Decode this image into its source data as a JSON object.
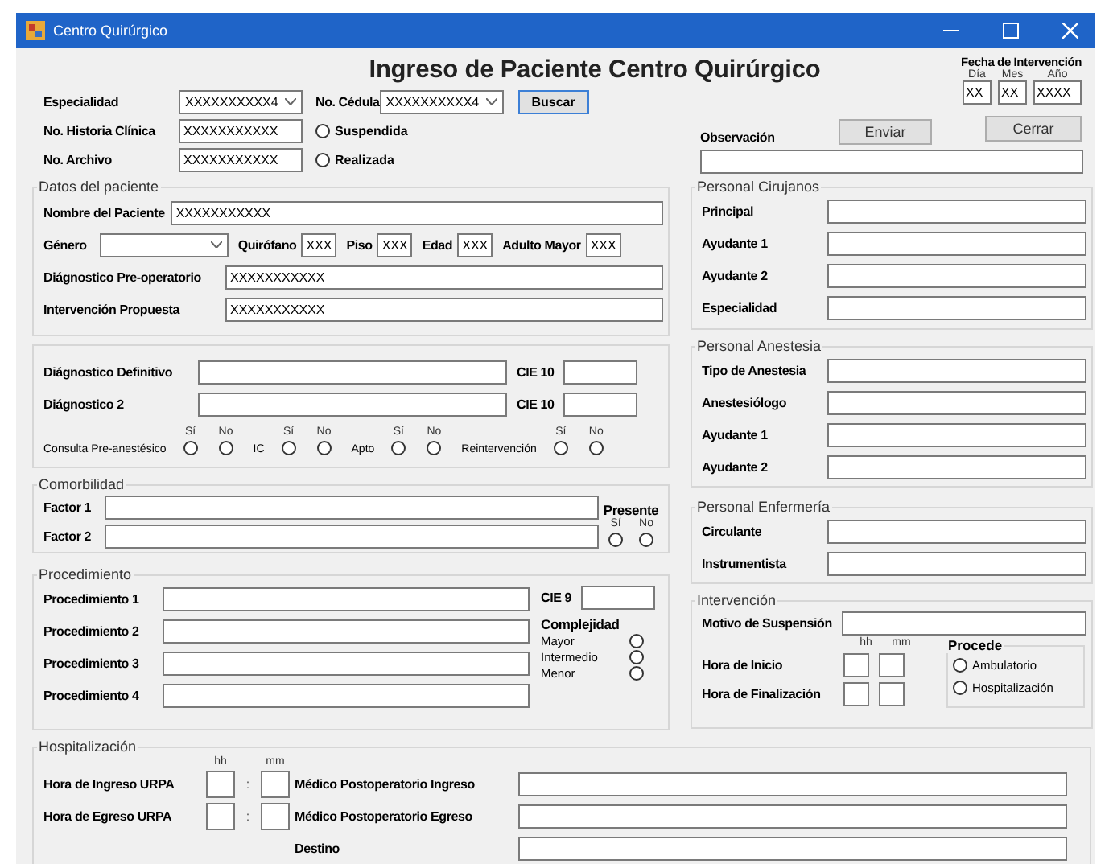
{
  "window": {
    "title": "Centro Quirúrgico"
  },
  "heading": "Ingreso de Paciente Centro Quirúrgico",
  "fecha": {
    "label": "Fecha de Intervención",
    "parts": [
      {
        "caption": "Día",
        "value": "XX"
      },
      {
        "caption": "Mes",
        "value": "XX"
      },
      {
        "caption": "Año",
        "value": "XXXX"
      }
    ]
  },
  "especialidad": {
    "label": "Especialidad",
    "value": "XXXXXXXXXX4"
  },
  "cedula": {
    "label": "No. Cédula",
    "value": "XXXXXXXXXX4"
  },
  "buscar": "Buscar",
  "historia": {
    "label": "No. Historia Clínica",
    "value": "XXXXXXXXXXX"
  },
  "archivo": {
    "label": "No. Archivo",
    "value": "XXXXXXXXXXX"
  },
  "estado": [
    {
      "label": "Suspendida",
      "selected": false
    },
    {
      "label": "Realizada",
      "selected": false
    }
  ],
  "observacion": {
    "label": "Observación"
  },
  "enviar": "Enviar",
  "cerrar": "Cerrar",
  "datos_paciente": {
    "title": "Datos del paciente",
    "nombre": {
      "label": "Nombre del Paciente",
      "value": "XXXXXXXXXXX"
    },
    "genero": {
      "label": "Género"
    },
    "small": [
      {
        "label": "Quirófano",
        "value": "XXX"
      },
      {
        "label": "Piso",
        "value": "XXX"
      },
      {
        "label": "Edad",
        "value": "XXX"
      },
      {
        "label": "Adulto Mayor",
        "value": "XXX"
      }
    ],
    "lines": [
      {
        "label": "Diágnostico Pre-operatorio",
        "value": "XXXXXXXXXXX"
      },
      {
        "label": "Intervención Propuesta",
        "value": "XXXXXXXXXXX"
      }
    ]
  },
  "diagnosticos": {
    "rows": [
      {
        "label": "Diágnostico Definitivo",
        "code_label": "CIE 10"
      },
      {
        "label": "Diágnostico 2",
        "code_label": "CIE 10"
      }
    ],
    "questions": [
      {
        "label": "Consulta Pre-anestésico",
        "options": [
          {
            "caption": "Sí",
            "selected": false
          },
          {
            "caption": "No",
            "selected": false
          }
        ]
      },
      {
        "label": "IC",
        "options": [
          {
            "caption": "Sí",
            "selected": false
          },
          {
            "caption": "No",
            "selected": false
          }
        ]
      },
      {
        "label": "Apto",
        "options": [
          {
            "caption": "Sí",
            "selected": false
          },
          {
            "caption": "No",
            "selected": false
          }
        ]
      },
      {
        "label": "Reintervención",
        "options": [
          {
            "caption": "Sí",
            "selected": false
          },
          {
            "caption": "No",
            "selected": false
          }
        ]
      }
    ]
  },
  "comorbilidad": {
    "title": "Comorbilidad",
    "factors": [
      "Factor 1",
      "Factor 2"
    ],
    "presente": {
      "label": "Presente",
      "options": [
        {
          "caption": "Sí",
          "selected": false
        },
        {
          "caption": "No",
          "selected": false
        }
      ]
    }
  },
  "procedimiento": {
    "title": "Procedimiento",
    "rows": [
      "Procedimiento 1",
      "Procedimiento 2",
      "Procedimiento 3",
      "Procedimiento 4"
    ],
    "cie_label": "CIE 9",
    "complejidad": {
      "label": "Complejidad",
      "options": [
        {
          "label": "Mayor",
          "selected": false
        },
        {
          "label": "Intermedio",
          "selected": false
        },
        {
          "label": "Menor",
          "selected": false
        }
      ]
    }
  },
  "cirujanos": {
    "title": "Personal Cirujanos",
    "fields": [
      "Principal",
      "Ayudante 1",
      "Ayudante 2",
      "Especialidad"
    ]
  },
  "anestesia": {
    "title": "Personal Anestesia",
    "fields": [
      "Tipo de Anestesia",
      "Anestesiólogo",
      "Ayudante 1",
      "Ayudante 2"
    ]
  },
  "enfermeria": {
    "title": "Personal Enfermería",
    "fields": [
      "Circulante",
      "Instrumentista"
    ]
  },
  "intervencion": {
    "title": "Intervención",
    "motivo_label": "Motivo de Suspensión",
    "time_captions": [
      "hh",
      "mm"
    ],
    "times": [
      "Hora de Inicio",
      "Hora de Finalización"
    ],
    "procede": {
      "label": "Procede",
      "options": [
        {
          "label": "Ambulatorio",
          "selected": false
        },
        {
          "label": "Hospitalización",
          "selected": false
        }
      ]
    }
  },
  "hospitalizacion": {
    "title": "Hospitalización",
    "time_captions": [
      "hh",
      "mm"
    ],
    "times": [
      {
        "label": "Hora de Ingreso URPA",
        "separator": ":"
      },
      {
        "label": "Hora de Egreso URPA",
        "separator": ":"
      }
    ],
    "medicos": [
      "Médico Postoperatorio Ingreso",
      "Médico Postoperatorio Egreso",
      "Destino"
    ]
  }
}
